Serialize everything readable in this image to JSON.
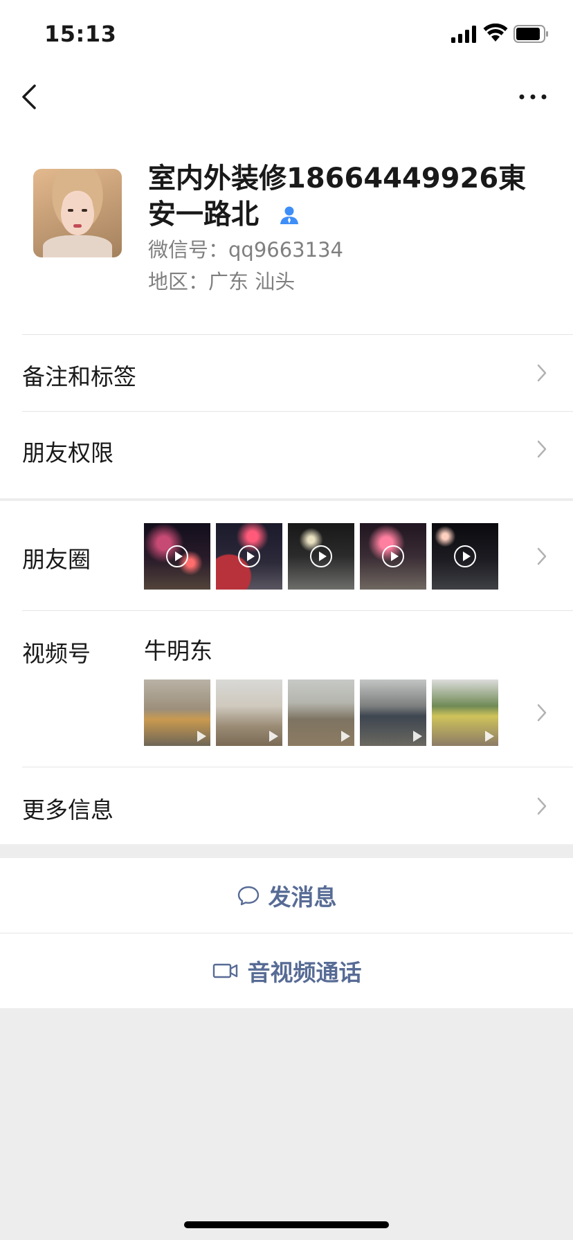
{
  "status_bar": {
    "time": "15:13"
  },
  "profile": {
    "name": "室内外装修18664449926東安一路北",
    "wechat_id": "微信号：qq9663134",
    "region": "地区：广东 汕头"
  },
  "rows": {
    "remarks_tags": "备注和标签",
    "friend_permissions": "朋友权限",
    "moments": "朋友圈",
    "channels": "视频号",
    "channels_name": "牛明东",
    "more_info": "更多信息"
  },
  "actions": {
    "send_message": "发消息",
    "av_call": "音视频通话"
  },
  "colors": {
    "link_blue": "#576b95",
    "background_gray": "#ededed",
    "verified_icon_blue": "#3e8ef7"
  },
  "icons": [
    "back-icon",
    "more-icon",
    "verified-icon",
    "chevron-right-icon",
    "chat-bubble-icon",
    "video-camera-icon",
    "play-icon"
  ]
}
